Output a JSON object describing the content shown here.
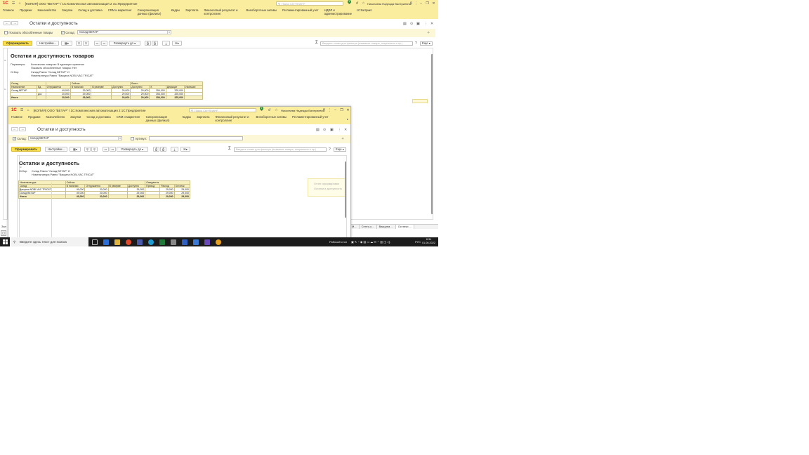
{
  "main_window": {
    "title": "[КОПИЯ] ООО \"ВЕТАР\" / 1С:Комплексная автоматизация 2 1С:Предприятие",
    "search_placeholder": "Поиск Ctrl+Shift+F",
    "badge": "1",
    "user": "Николаева Надежда Валериевна",
    "menu": [
      "Главное",
      "Продажи",
      "Казначейство",
      "Закупки",
      "Склад и доставка",
      "CRM и маркетинг",
      "Синхронизация данных (филиал)",
      "Кадры",
      "Зарплата",
      "Финансовый результат и контроллинг",
      "Внеоборотные активы",
      "Регламентированный учет",
      "НДФЛ и администрирование",
      "1С:Битрикс"
    ],
    "form_title": "Остатки и доступность",
    "show_separate_label": "Показать обособленные товары",
    "warehouse_label": "Склад:",
    "warehouse_value": "Склад ВЕТАР",
    "generate_label": "Сформировать",
    "settings_label": "Настройки...",
    "expand_label": "Развернуть до",
    "search_placeholder_report": "Введите слово для фильтра (название товара, покупателя и пр.)",
    "more_label": "Еще",
    "report": {
      "title": "Остатки и доступность товаров",
      "params_label": "Параметры:",
      "params_lines": [
        "Количество товаров: В единицах хранения",
        "Показать обособленные товары: Нет"
      ],
      "filter_label": "Отбор:",
      "filter_lines": [
        "Склад Равно \"Склад ВЕТАР\" И",
        "Номенклатура Равно \"Вакцина NOBI-VAC TRICAT\""
      ],
      "groups": {
        "warehouse": "Склад",
        "now": "Сейчас",
        "total": "Всего"
      },
      "headers": [
        "Назначение",
        "Ед.",
        "Отгружается",
        "В наличии",
        "В резерве",
        "Доступно",
        "Доступно",
        "К",
        "Дефицит",
        "Излишек"
      ],
      "rows": [
        [
          "Склад ВЕТАР",
          "",
          "49,000",
          "29,000",
          "",
          "29,000",
          "29,000",
          "354,000",
          "325,000",
          ""
        ],
        [
          "",
          "доз",
          "20,000",
          "29,000",
          "",
          "29,000",
          "29,000",
          "354,000",
          "325,000",
          ""
        ]
      ],
      "total": [
        "Итого",
        "",
        "20,000",
        "29,000",
        "",
        "29,000",
        "29,000",
        "354,000",
        "325,000",
        ""
      ]
    }
  },
  "second_window": {
    "title": "[КОПИЯ] ООО \"ВЕТАР\" / 1С:Комплексная автоматизация 2 1С:Предприятие",
    "search_placeholder": "Поиск Ctrl+Shift+F",
    "badge": "1",
    "user": "Николаева Надежда Валериевна",
    "menu": [
      "Главное",
      "Продажи",
      "Казначейство",
      "Закупки",
      "Склад и доставка",
      "CRM и маркетинг",
      "Синхронизация данных (филиал)",
      "Кадры",
      "Зарплата",
      "Финансовый результат и контроллинг",
      "Внеоборотные активы",
      "Регламентированный учет"
    ],
    "form_title": "Остатки и доступность",
    "warehouse_label": "Склад:",
    "warehouse_value": "Склад ВЕТАР",
    "article_label": "Артикул:",
    "generate_label": "Сформировать",
    "settings_label": "Настройки...",
    "expand_label": "Развернуть до",
    "search_placeholder_report": "Введите слово для фильтра (название товара, покупателя и пр.)",
    "more_label": "Еще",
    "report": {
      "title": "Остатки и доступность",
      "filter_label": "Отбор:",
      "filter_lines": [
        "Склад Равно \"Склад ВЕТАР\" И",
        "Номенклатура Равно \"Вакцина NOBI-VAC TRICAT\""
      ],
      "groups": {
        "nomenclature": "Номенклатура",
        "now": "Сейчас",
        "expected": "Ожидается"
      },
      "headers": [
        "Склад",
        "В наличии",
        "Отгружается",
        "В резерве",
        "Доступно",
        "Приход",
        "Расход",
        "Остаток"
      ],
      "rows": [
        [
          "Вакцина NOBI-VAC TRICAT",
          "49,000",
          "20,000",
          "",
          "29,000",
          "",
          "29,000",
          "29,000"
        ],
        [
          "Склад ВЕТАР",
          "49,000",
          "20,000",
          "",
          "29,000",
          "",
          "29,000",
          "29,000"
        ]
      ],
      "total": [
        "Итого",
        "49,000",
        "20,000",
        "",
        "29,000",
        "",
        "29,000",
        "29,000"
      ]
    },
    "toast_lines": [
      "Отчет сформирован",
      "Остатки и доступность"
    ]
  },
  "bottom_tabs": [
    "М...",
    "Септо-с...",
    "Вакцина ...",
    "Остатки ..."
  ],
  "taskbar": {
    "search_text": "Введите здесь текст для поиска",
    "desktop_label": "Рабочий стол",
    "lang": "РУС",
    "time": "8:34",
    "date": "01.06.2022",
    "left_stub": "Зап"
  },
  "colors": {
    "accent_yellow": "#fbed9e",
    "primary_button": "#fbe04d",
    "report_header": "#f8efbf"
  }
}
